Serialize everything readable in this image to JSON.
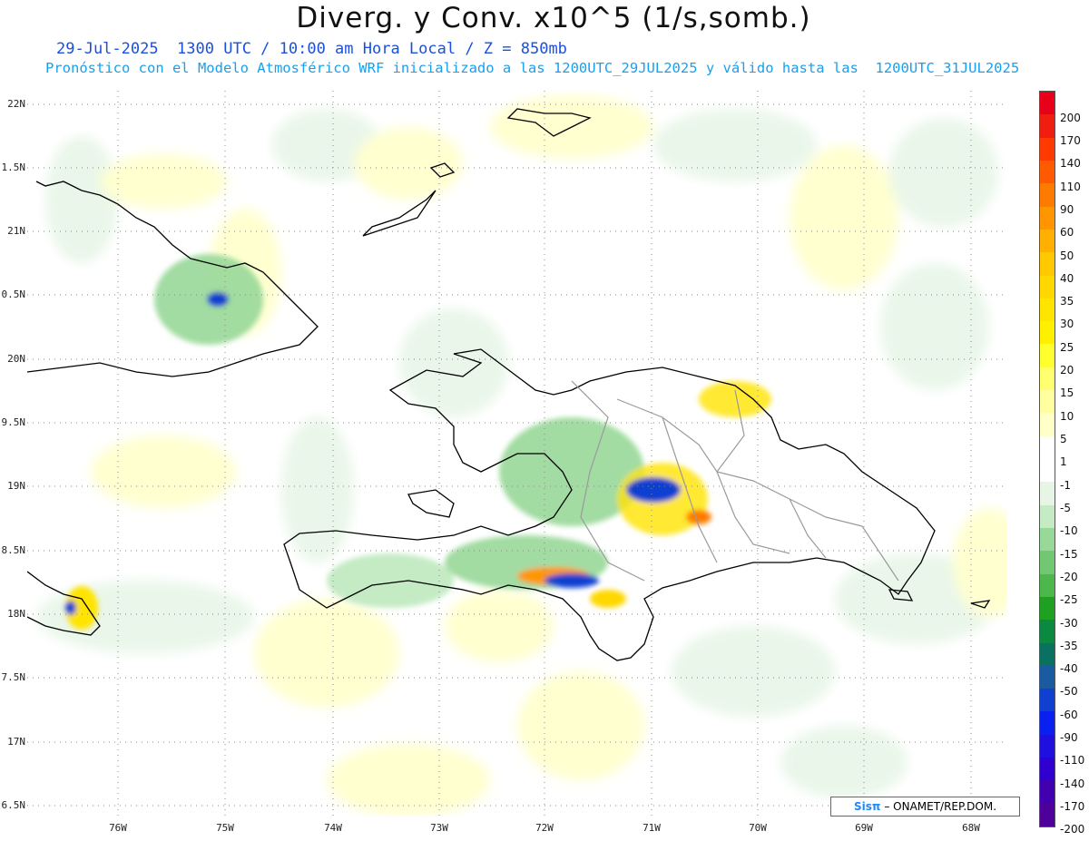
{
  "title": "Diverg. y Conv. x10^5 (1/s,somb.)",
  "subtitle1": "29-Jul-2025  1300 UTC / 10:00 am Hora Local / Z = 850mb",
  "subtitle2": "Pronóstico con el Modelo Atmosférico WRF inicializado a las 1200UTC_29JUL2025 y válido hasta las  1200UTC_31JUL2025",
  "lat_labels": [
    "22N",
    "1.5N",
    "21N",
    "0.5N",
    "20N",
    "9.5N",
    "19N",
    "8.5N",
    "18N",
    "7.5N",
    "17N",
    "6.5N"
  ],
  "lon_labels": [
    "76W",
    "75W",
    "74W",
    "73W",
    "72W",
    "71W",
    "70W",
    "69W",
    "68W"
  ],
  "legend": {
    "labels": [
      "200",
      "170",
      "140",
      "110",
      "90",
      "60",
      "50",
      "40",
      "35",
      "30",
      "25",
      "20",
      "15",
      "10",
      "5",
      "1",
      "-1",
      "-5",
      "-10",
      "-15",
      "-20",
      "-25",
      "-30",
      "-35",
      "-40",
      "-50",
      "-60",
      "-90",
      "-110",
      "-140",
      "-170",
      "-200"
    ],
    "colors": [
      "#e8001a",
      "#f01e10",
      "#ff3a00",
      "#ff5a00",
      "#ff7a00",
      "#ff9600",
      "#ffb000",
      "#ffc800",
      "#ffd800",
      "#ffe400",
      "#fff000",
      "#ffff30",
      "#ffff70",
      "#ffffa0",
      "#ffffc8",
      "#ffffff",
      "#ffffff",
      "#e6f5e6",
      "#c4ebc4",
      "#98d898",
      "#72c872",
      "#4cb84c",
      "#20a020",
      "#0a8a40",
      "#0a7060",
      "#1a5aa0",
      "#1040d0",
      "#0a20f0",
      "#2010e0",
      "#3000d0",
      "#4000b0",
      "#50009a"
    ]
  },
  "credit": {
    "logo": "Sisπ",
    "text": "– ONAMET/REP.DOM."
  },
  "colors": {
    "coast": "#000000",
    "provinces": "#9a9a9a",
    "grid": "#888888",
    "title_blue": "#1a4fe0",
    "subtitle_cyan": "#18a0f0"
  }
}
